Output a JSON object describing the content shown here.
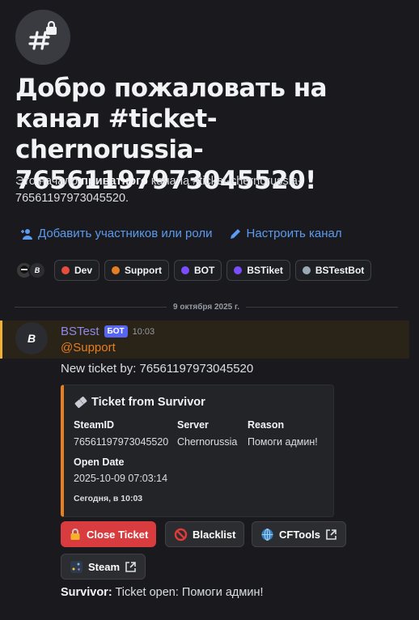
{
  "welcome": {
    "title": "Добро пожаловать на канал #ticket-chernorussia-76561197973045520!",
    "sub_prefix": "Это начало ",
    "sub_bold": "приватного",
    "sub_suffix": " канала #ticket-chernorussia-76561197973045520."
  },
  "actions": {
    "add_members": "Добавить участников или роли",
    "configure": "Настроить канал"
  },
  "avatars": [
    "B"
  ],
  "roles": [
    {
      "label": "Dev",
      "color": "#e74c3c"
    },
    {
      "label": "Support",
      "color": "#e67e22"
    },
    {
      "label": "BOT",
      "color": "#7c4dff"
    },
    {
      "label": "BSTiket",
      "color": "#7c4dff"
    },
    {
      "label": "BSTestBot",
      "color": "#99aab5"
    }
  ],
  "date_divider": "9 октября 2025 г.",
  "message": {
    "author": "BSTest",
    "bot_tag": "БОТ",
    "time": "10:03",
    "avatar_letter": "B",
    "mention": "@Support",
    "text": "New ticket by: 76561197973045520",
    "embed": {
      "title": "Ticket from Survivor",
      "fields": [
        {
          "name": "SteamID",
          "value": "76561197973045520"
        },
        {
          "name": "Server",
          "value": "Chernorussia"
        },
        {
          "name": "Reason",
          "value": "Помоги админ!"
        },
        {
          "name": "Open Date",
          "value": "2025-10-09 07:03:14"
        }
      ],
      "footer": "Сегодня, в 10:03"
    },
    "buttons": {
      "close": "Close Ticket",
      "blacklist": "Blacklist",
      "cftools": "CFTools",
      "steam": "Steam"
    }
  },
  "final_line": {
    "author": "Survivor:",
    "text": " Ticket open: Помоги админ!"
  },
  "colors": {
    "link": "#5b9bf0",
    "mention": "#e67e22",
    "danger": "#d83c3e",
    "bot_badge": "#5865f2"
  }
}
